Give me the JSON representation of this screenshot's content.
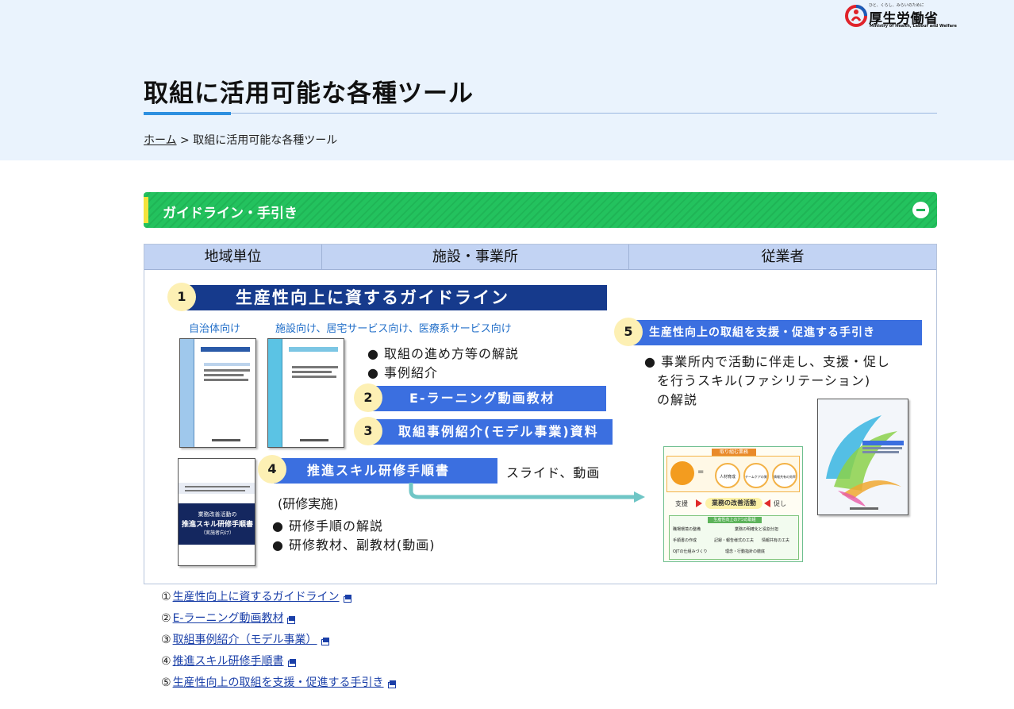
{
  "header": {
    "logo": {
      "tagline": "ひと、くらし、みらいのために",
      "name": "厚生労働省",
      "english": "Ministry of Health, Labour and Welfare"
    },
    "title": "取組に活用可能な各種ツール",
    "breadcrumb": {
      "home": "ホーム",
      "separator": ">",
      "current": "取組に活用可能な各種ツール"
    }
  },
  "section": {
    "title": "ガイドライン・手引き",
    "toggle": "collapse"
  },
  "figure": {
    "columns": [
      "地域単位",
      "施設・事業所",
      "従業者"
    ],
    "item1": {
      "number": "1",
      "title": "生産性向上に資するガイドライン",
      "target_a": "自治体向け",
      "target_b": "施設向け、居宅サービス向け、医療系サービス向け",
      "bullets": [
        "取組の進め方等の解説",
        "事例紹介"
      ]
    },
    "item2": {
      "number": "2",
      "title": "E-ラーニング動画教材"
    },
    "item3": {
      "number": "3",
      "title": "取組事例紹介(モデル事業)資料"
    },
    "item4": {
      "number": "4",
      "title": "推進スキル研修手順書",
      "side": "スライド、動画",
      "note": "(研修実施)",
      "bullets": [
        "研修手順の解説",
        "研修教材、副教材(動画)"
      ],
      "cover_title_1": "業務改善活動の",
      "cover_title_2": "推進スキル研修手順書",
      "cover_title_3": "（実施者向け）"
    },
    "item5": {
      "number": "5",
      "title": "生産性向上の取組を支援・促進する手引き",
      "bullets": [
        "事業所内で活動に伴走し、支援・促し",
        "を行うスキル(ファシリテーション)",
        "の解説"
      ]
    },
    "diagram": {
      "header": "取り組む業務",
      "pillars": [
        "人材育成",
        "チームケアの質の向上",
        "情報共有の効率化"
      ],
      "left_label": "支援",
      "center_label": "業務の改善活動",
      "right_label": "促し",
      "sub_header": "生産性向上の7つの取組",
      "items": [
        "職場環境の整備",
        "業務の明確化と役割分担",
        "手順書の作成",
        "記録・報告様式の工夫",
        "情報共有の工夫",
        "OJTの仕組みづくり",
        "理念・行動指針の徹底"
      ]
    },
    "colors": {
      "navy": "#163a8c",
      "blue": "#3b6fe0",
      "green": "#21bd5b",
      "teal_arrow": "#6fc6c6",
      "badge": "#fdf0b4"
    }
  },
  "links": [
    {
      "index": "①",
      "label": "生産性向上に資するガイドライン"
    },
    {
      "index": "②",
      "label": "E-ラーニング動画教材"
    },
    {
      "index": "③",
      "label": "取組事例紹介（モデル事業）"
    },
    {
      "index": "④",
      "label": "推進スキル研修手順書"
    },
    {
      "index": "⑤",
      "label": "生産性向上の取組を支援・促進する手引き"
    }
  ]
}
